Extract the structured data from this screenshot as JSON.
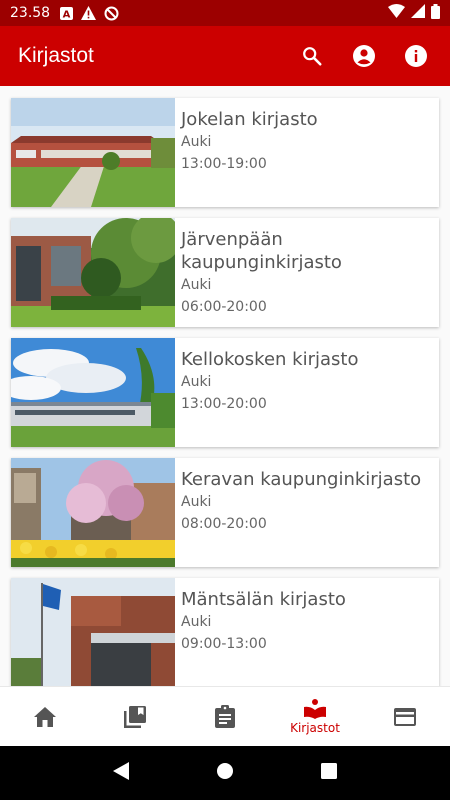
{
  "status_bar": {
    "time": "23.58",
    "icons": [
      "a-notification-icon",
      "warning-icon",
      "dnd-icon",
      "wifi-icon",
      "signal-icon",
      "battery-icon"
    ]
  },
  "app_bar": {
    "title": "Kirjastot",
    "actions": [
      "search-icon",
      "account-icon",
      "info-icon"
    ]
  },
  "libraries": [
    {
      "name": "Jokelan kirjasto",
      "status": "Auki",
      "hours": "13:00-19:00"
    },
    {
      "name": "Järvenpään kaupunginkirjasto",
      "status": "Auki",
      "hours": "06:00-20:00"
    },
    {
      "name": "Kellokosken kirjasto",
      "status": "Auki",
      "hours": "13:00-20:00"
    },
    {
      "name": "Keravan kaupunginkirjasto",
      "status": "Auki",
      "hours": "08:00-20:00"
    },
    {
      "name": "Mäntsälän kirjasto",
      "status": "Auki",
      "hours": "09:00-13:00"
    }
  ],
  "bottom_nav": {
    "items": [
      {
        "icon": "home-icon",
        "label": ""
      },
      {
        "icon": "library-books-icon",
        "label": ""
      },
      {
        "icon": "clipboard-icon",
        "label": ""
      },
      {
        "icon": "library-icon",
        "label": "Kirjastot",
        "active": true
      },
      {
        "icon": "card-icon",
        "label": ""
      }
    ]
  },
  "colors": {
    "status_bar": "#9c0000",
    "app_bar": "#cc0000",
    "accent": "#cc0000",
    "inactive_icon": "#555555"
  }
}
